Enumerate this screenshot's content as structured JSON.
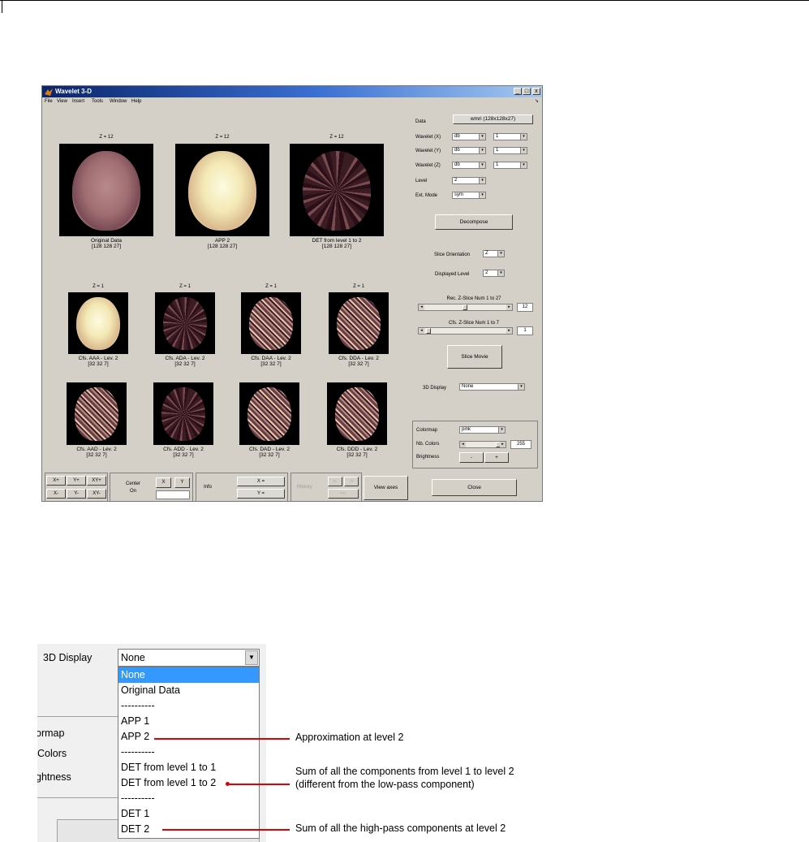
{
  "window": {
    "title": "Wavelet 3-D",
    "controls": [
      "_",
      "□",
      "x"
    ],
    "menu": [
      "File",
      "View",
      "Insert",
      "Tools",
      "Window",
      "Help"
    ]
  },
  "top_images": [
    {
      "z": "Z = 12",
      "caption1": "Original Data",
      "caption2": "[128  128   27]",
      "tone": "original"
    },
    {
      "z": "Z = 12",
      "caption1": "APP 2",
      "caption2": "[128  128   27]",
      "tone": "app"
    },
    {
      "z": "Z = 12",
      "caption1": "DET from level 1 to 2",
      "caption2": "[128  128   27]",
      "tone": "det"
    }
  ],
  "coef_row1": [
    {
      "z": "Z = 1",
      "caption1": "Cfs. AAA - Lev. 2",
      "caption2": "[32  32   7]",
      "tone": "app"
    },
    {
      "z": "Z = 1",
      "caption1": "Cfs. ADA - Lev. 2",
      "caption2": "[32  32   7]",
      "tone": "det"
    },
    {
      "z": "Z = 1",
      "caption1": "Cfs. DAA - Lev. 2",
      "caption2": "[32  32   7]",
      "tone": "mix"
    },
    {
      "z": "Z = 1",
      "caption1": "Cfs. DDA - Lev. 2",
      "caption2": "[32  32   7]",
      "tone": "mix"
    }
  ],
  "coef_row2": [
    {
      "caption1": "Cfs. AAD - Lev. 2",
      "caption2": "[32  32   7]",
      "tone": "mix"
    },
    {
      "caption1": "Cfs. ADD - Lev. 2",
      "caption2": "[32  32   7]",
      "tone": "det"
    },
    {
      "caption1": "Cfs. DAD - Lev. 2",
      "caption2": "[32  32   7]",
      "tone": "mix"
    },
    {
      "caption1": "Cfs. DDD - Lev. 2",
      "caption2": "[32  32   7]",
      "tone": "mix"
    }
  ],
  "panel": {
    "data_label": "Data",
    "data_value": "wmri  (128x128x27)",
    "wavelet_x_label": "Wavelet (X)",
    "wavelet_y_label": "Wavelet (Y)",
    "wavelet_z_label": "Wavelet (Z)",
    "wavelet_family": "db",
    "wavelet_order": "1",
    "level_label": "Level",
    "level_value": "2",
    "ext_mode_label": "Ext. Mode",
    "ext_mode_value": "sym",
    "decompose": "Decompose",
    "slice_orientation_label": "Slice Orientation",
    "slice_orientation_value": "Z",
    "displayed_level_label": "Displayed Level",
    "displayed_level_value": "2",
    "rec_slice_label": "Rec. Z-Slice Num 1 to 27",
    "rec_slice_value": "12",
    "cfs_slice_label": "Cfs. Z-Slice Num 1 to 7",
    "cfs_slice_value": "1",
    "slice_movie": "Slice Movie",
    "display3d_label": "3D Display",
    "display3d_value": "None",
    "colormap_label": "Colormap",
    "colormap_value": "pink",
    "nb_colors_label": "Nb. Colors",
    "nb_colors_value": "255",
    "brightness_label": "Brightness",
    "brightness_minus": "-",
    "brightness_plus": "+",
    "close": "Close"
  },
  "toolbar": {
    "xplus": "X+",
    "yplus": "Y+",
    "xyplus": "XY+",
    "xminus": "X-",
    "yminus": "Y-",
    "xyminus": "XY-",
    "center": "Center",
    "on": "On",
    "x": "X",
    "y": "Y",
    "info": "Info",
    "xeq": "X =",
    "yeq": "Y =",
    "history": "History",
    "hist_left": "<-",
    "hist_right": "->",
    "hist_lll": "<<-",
    "view_axes": "View axes"
  },
  "zoom": {
    "label_3d": "3D Display",
    "selected": "None",
    "options": [
      "None",
      "Original Data",
      "----------",
      "APP 1",
      "APP 2",
      "----------",
      "DET from level 1 to 1",
      "DET from level 1 to 2",
      "----------",
      "DET 1",
      "DET 2"
    ],
    "cut_labels": [
      "ormap",
      "Colors",
      "ghtness"
    ]
  },
  "annotations": {
    "app2": "Approximation at level 2",
    "det12_line1": "Sum of all the components from level 1 to level 2",
    "det12_line2": "(different from the low-pass component)",
    "det2": "Sum of all the high-pass components at level 2"
  }
}
